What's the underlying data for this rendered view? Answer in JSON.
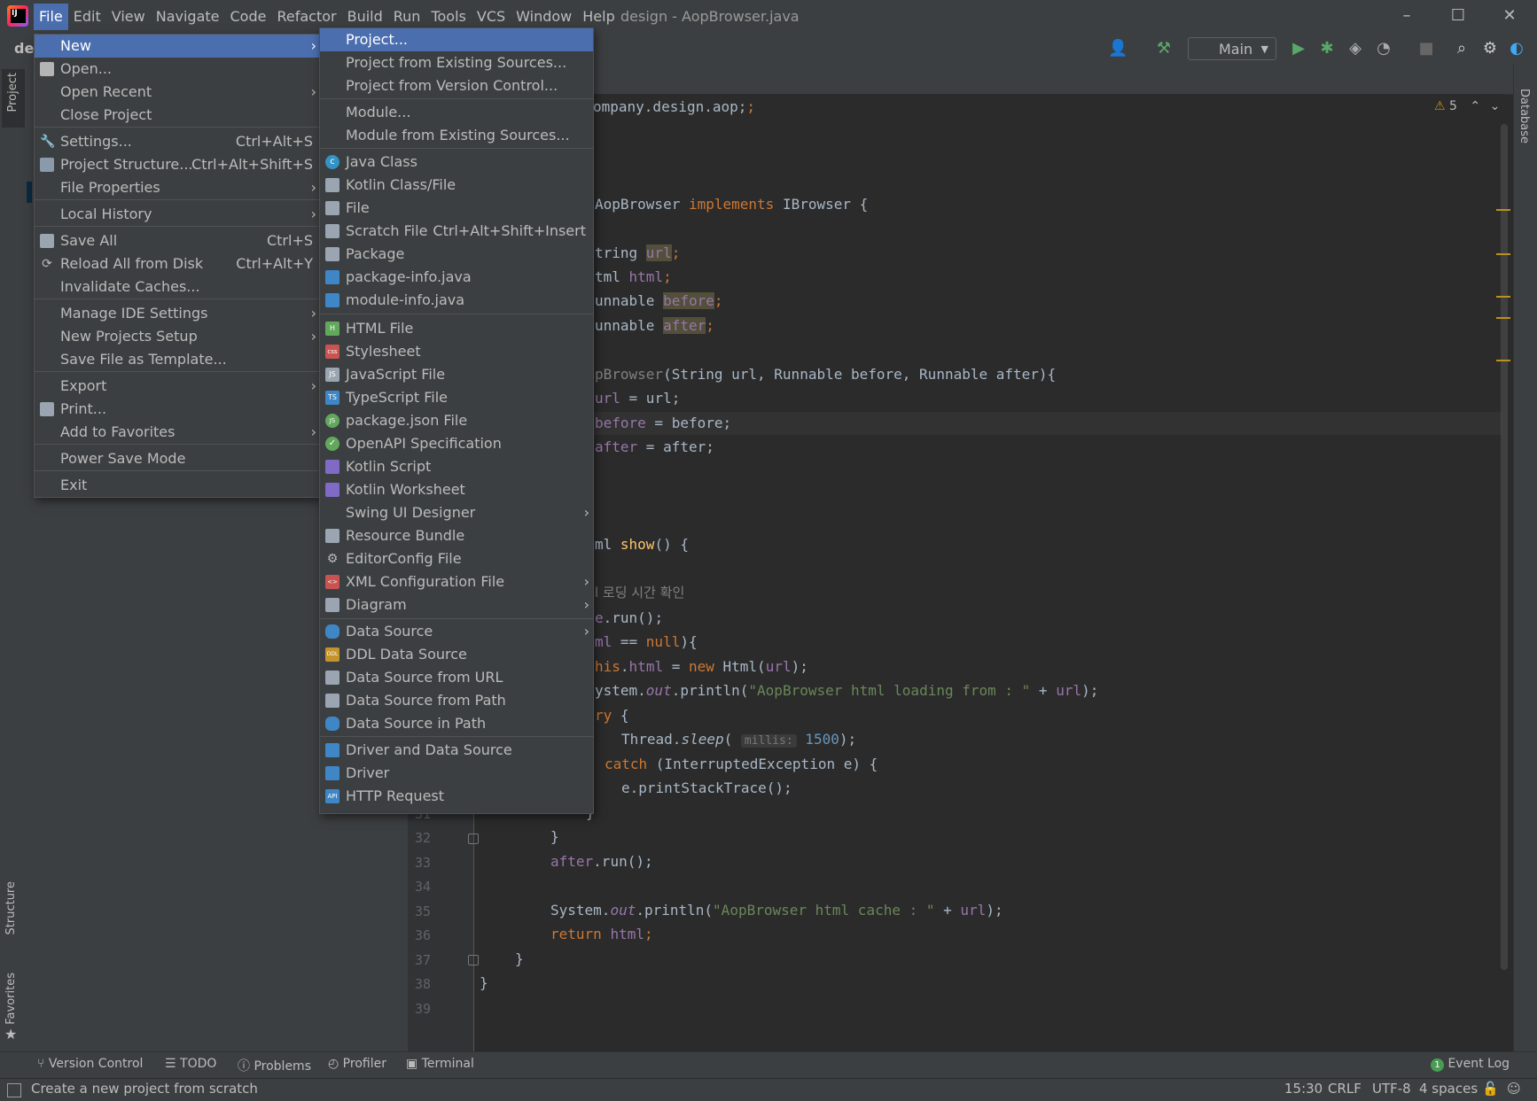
{
  "window": {
    "title": "design - AopBrowser.java",
    "menus": [
      "File",
      "Edit",
      "View",
      "Navigate",
      "Code",
      "Refactor",
      "Build",
      "Run",
      "Tools",
      "VCS",
      "Window",
      "Help"
    ],
    "min": "–",
    "max": "☐",
    "close": "✕",
    "project_label": "des"
  },
  "toolbar": {
    "run_config": "Main"
  },
  "side": {
    "project": "Project",
    "structure": "Structure",
    "favorites": "Favorites",
    "database": "Database"
  },
  "file_menu": {
    "new": "New",
    "open": "Open...",
    "open_recent": "Open Recent",
    "close_project": "Close Project",
    "settings": "Settings...",
    "settings_sc": "Ctrl+Alt+S",
    "project_structure": "Project Structure...",
    "project_structure_sc": "Ctrl+Alt+Shift+S",
    "file_properties": "File Properties",
    "local_history": "Local History",
    "save_all": "Save All",
    "save_all_sc": "Ctrl+S",
    "reload": "Reload All from Disk",
    "reload_sc": "Ctrl+Alt+Y",
    "invalidate": "Invalidate Caches...",
    "manage_ide": "Manage IDE Settings",
    "new_projects_setup": "New Projects Setup",
    "save_template": "Save File as Template...",
    "export": "Export",
    "print": "Print...",
    "add_favorites": "Add to Favorites",
    "power_save": "Power Save Mode",
    "exit": "Exit"
  },
  "new_menu": {
    "project": "Project...",
    "project_existing": "Project from Existing Sources...",
    "project_vcs": "Project from Version Control...",
    "module": "Module...",
    "module_existing": "Module from Existing Sources...",
    "java_class": "Java Class",
    "kotlin_class": "Kotlin Class/File",
    "file": "File",
    "scratch": "Scratch File",
    "scratch_sc": "Ctrl+Alt+Shift+Insert",
    "package": "Package",
    "package_info": "package-info.java",
    "module_info": "module-info.java",
    "html": "HTML File",
    "stylesheet": "Stylesheet",
    "javascript": "JavaScript File",
    "typescript": "TypeScript File",
    "package_json": "package.json File",
    "openapi": "OpenAPI Specification",
    "kotlin_script": "Kotlin Script",
    "kotlin_worksheet": "Kotlin Worksheet",
    "swing": "Swing UI Designer",
    "resource_bundle": "Resource Bundle",
    "editorconfig": "EditorConfig File",
    "xml_config": "XML Configuration File",
    "diagram": "Diagram",
    "data_source": "Data Source",
    "ddl": "DDL Data Source",
    "ds_url": "Data Source from URL",
    "ds_path": "Data Source from Path",
    "ds_in_path": "Data Source in Path",
    "driver_ds": "Driver and Data Source",
    "driver": "Driver",
    "http": "HTTP Request"
  },
  "editor": {
    "warnings": "5",
    "lines": {
      "l1": "ompany.design.aop;",
      "l5a": "AopBrowser ",
      "l5b": "implements ",
      "l5c": "IBrowser {",
      "l7a": "tring ",
      "l7b": "url",
      "l7c": ";",
      "l8a": "tml ",
      "l8b": "html",
      "l8c": ";",
      "l9a": "unnable ",
      "l9b": "before",
      "l9c": ";",
      "l10a": "unnable ",
      "l10b": "after",
      "l10c": ";",
      "l12a": "pBrowser",
      "l12b": "(String url, Runnable before, Runnable after){",
      "l13a": "url",
      "l13b": " = url;",
      "l14a": "before",
      "l14b": " = before;",
      "l15a": "after",
      "l15b": " = after;",
      "l19a": "ml ",
      "l19b": "show",
      "l19c": "() {",
      "l21": "l 로딩 시간 확인",
      "l22a": "e",
      "l22b": ".run();",
      "l23a": "ml",
      "l23b": " == ",
      "l23c": "null",
      "l23d": "){",
      "l24a": "his",
      "l24b": ".",
      "l24c": "html",
      "l24d": " = ",
      "l24e": "new ",
      "l24f": "Html(",
      "l24g": "url",
      "l24h": ");",
      "l25a": "ystem.",
      "l25b": "out",
      "l25c": ".println(",
      "l25d": "\"AopBrowser html loading from : \"",
      "l25e": " + ",
      "l25f": "url",
      "l25g": ");",
      "l26a": "ry",
      "l26b": " {",
      "l27a": "Thread.",
      "l27b": "sleep",
      "l27c": "( ",
      "l27d": "millis:",
      "l27e": " 1500",
      "l27f": ");",
      "l28a": "catch ",
      "l28b": "(InterruptedException e) {",
      "l29": "e.printStackTrace();",
      "l31": "}",
      "l32": "}",
      "l33a": "after",
      "l33b": ".run();",
      "l35a": "System.",
      "l35b": "out",
      "l35c": ".println(",
      "l35d": "\"AopBrowser html cache : \"",
      "l35e": " + ",
      "l35f": "url",
      "l35g": ");",
      "l36a": "return ",
      "l36b": "html",
      "l36c": ";",
      "l37": "}",
      "l38": "}"
    },
    "line_numbers": [
      "31",
      "32",
      "33",
      "34",
      "35",
      "36",
      "37",
      "38",
      "39"
    ]
  },
  "bottom": {
    "vc": "Version Control",
    "todo": "TODO",
    "problems": "Problems",
    "profiler": "Profiler",
    "terminal": "Terminal",
    "event_log": "Event Log",
    "event_count": "1"
  },
  "status": {
    "message": "Create a new project from scratch",
    "position": "15:30",
    "line_sep": "CRLF",
    "encoding": "UTF-8",
    "indent": "4 spaces"
  },
  "colors": {
    "accent": "#4b6eaf",
    "bg": "#2b2b2b",
    "panel": "#3c3f41"
  }
}
